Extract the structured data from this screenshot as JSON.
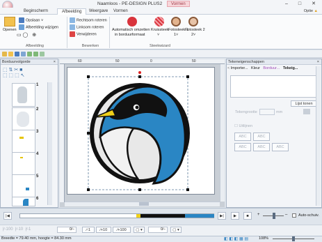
{
  "window": {
    "title": "Naamloos - PE-DESIGN PLUS2",
    "context_tab": "Vormen",
    "controls": [
      "–",
      "□",
      "✕"
    ]
  },
  "ribbon_tabs": [
    "Beginscherm",
    "Afbeelding",
    "Weergave",
    "Vormen"
  ],
  "active_tab": "Afbeelding",
  "optie_label": "Optie",
  "ribbon": {
    "afbeelding": {
      "openen": "Openen",
      "opslaan": "Opslaan ˅",
      "wijzigen": "Afbeelding wijzigen",
      "group": "Afbeelding"
    },
    "bewerken": {
      "rechtsom": "Rechtsom roteren",
      "linksom": "Linksom roteren",
      "verwijderen": "Verwijderen",
      "group": "Bewerken"
    },
    "steekwizard": {
      "auto_line1": "Automatisch omzetten",
      "auto_line2": "in borduurformaat",
      "kruissteek": "Kruissteek",
      "fotosteek1": "Fotosteek 1",
      "fotosteek2": "Fotosteek 2",
      "sub1": "˅",
      "sub2": "1˅",
      "sub3": "2˅",
      "group": "Steekwizard"
    }
  },
  "left_panel": {
    "title": "Borduurvolgorde",
    "close": "×",
    "items": [
      "1",
      "2",
      "3",
      "4",
      "5",
      "6"
    ]
  },
  "ruler_labels": [
    "60",
    "50",
    "0",
    "50"
  ],
  "right_panel": {
    "title": "Tekeneigenschappen",
    "close": "×",
    "tabs": [
      "Importer...",
      "Kleur",
      "Borduur...",
      "Tekeig..."
    ],
    "lijst_button": "Lijst tonen",
    "grootte_label": "Tekengrootte",
    "unit": "mm",
    "uitlijnen_label": "Uitlijnen",
    "abc_buttons": [
      "ABC",
      "ABC",
      "ABC",
      "ABC",
      "ABC"
    ]
  },
  "transport": {
    "zoom_plus": "+",
    "zoom_minus": "–",
    "auto_schuiven": "Auto-schuiv."
  },
  "bottom_toolbar": {
    "values": [
      "0∕–",
      "0∕–"
    ],
    "buttons": [
      "∕-1",
      "∕+10",
      "∕+100"
    ]
  },
  "status": {
    "dimensions": "Breedte = 79.40 mm, hoogte = 84.30 mm",
    "zoom": "108%"
  },
  "colors": {
    "accent": "#2f80c0",
    "ribbon_bg": "#fafbfc",
    "canvas": "#c9cfd6",
    "penguin_blue": "#2a86c4"
  }
}
